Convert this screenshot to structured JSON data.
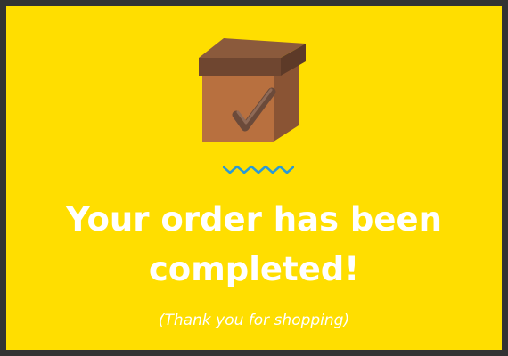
{
  "confirmation": {
    "icon": "package-box-checkmark-icon",
    "divider_icon": "wavy-line-icon",
    "headline": "Your order has been completed!",
    "subline": "(Thank you for shopping)"
  },
  "colors": {
    "background": "#ffde00",
    "border": "#333333",
    "text": "#ffffff",
    "divider": "#2a9ad6",
    "box_lid": "#7a4d35",
    "box_front": "#b8703f",
    "box_side": "#8a5434"
  }
}
